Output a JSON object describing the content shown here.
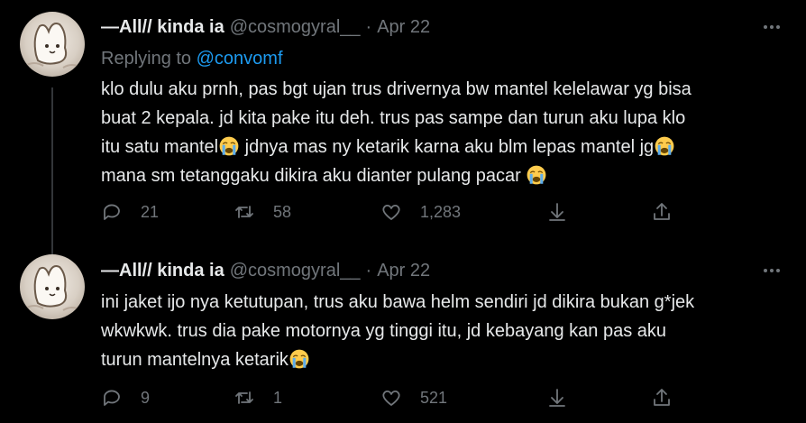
{
  "tweets": [
    {
      "name": "—All// kinda ia",
      "handle": "@cosmogyral__",
      "separator": "·",
      "date": "Apr 22",
      "replying_prefix": "Replying to",
      "replying_to": "@convomf",
      "text_segments": [
        "klo dulu aku prnh, pas bgt ujan trus drivernya bw mantel kelelawar yg bisa\nbuat 2 kepala. jd kita pake itu deh. trus pas sampe dan turun aku lupa klo\nitu satu mantel",
        " jdnya mas ny ketarik karna aku blm lepas mantel jg",
        "\nmana sm tetanggaku dikira aku dianter pulang pacar "
      ],
      "emoji": "crying-face-emoji",
      "actions": {
        "replies": "21",
        "retweets": "58",
        "likes": "1,283"
      }
    },
    {
      "name": "—All// kinda ia",
      "handle": "@cosmogyral__",
      "separator": "·",
      "date": "Apr 22",
      "text_segments": [
        "ini jaket ijo nya ketutupan, trus aku bawa helm sendiri jd dikira bukan g*jek\nwkwkwk. trus dia pake motornya yg tinggi itu, jd kebayang kan pas aku\nturun mantelnya ketarik"
      ],
      "emoji": "crying-face-emoji",
      "actions": {
        "replies": "9",
        "retweets": "1",
        "likes": "521"
      }
    }
  ],
  "icons": {
    "reply": "reply-icon",
    "retweet": "retweet-icon",
    "like": "heart-icon",
    "share": "share-down-icon",
    "upload": "upload-icon",
    "more": "more-dots-icon"
  },
  "colors": {
    "background": "#000000",
    "text": "#e7e9ea",
    "muted": "#71767b",
    "link": "#1d9bf0",
    "thread_line": "#333639"
  }
}
